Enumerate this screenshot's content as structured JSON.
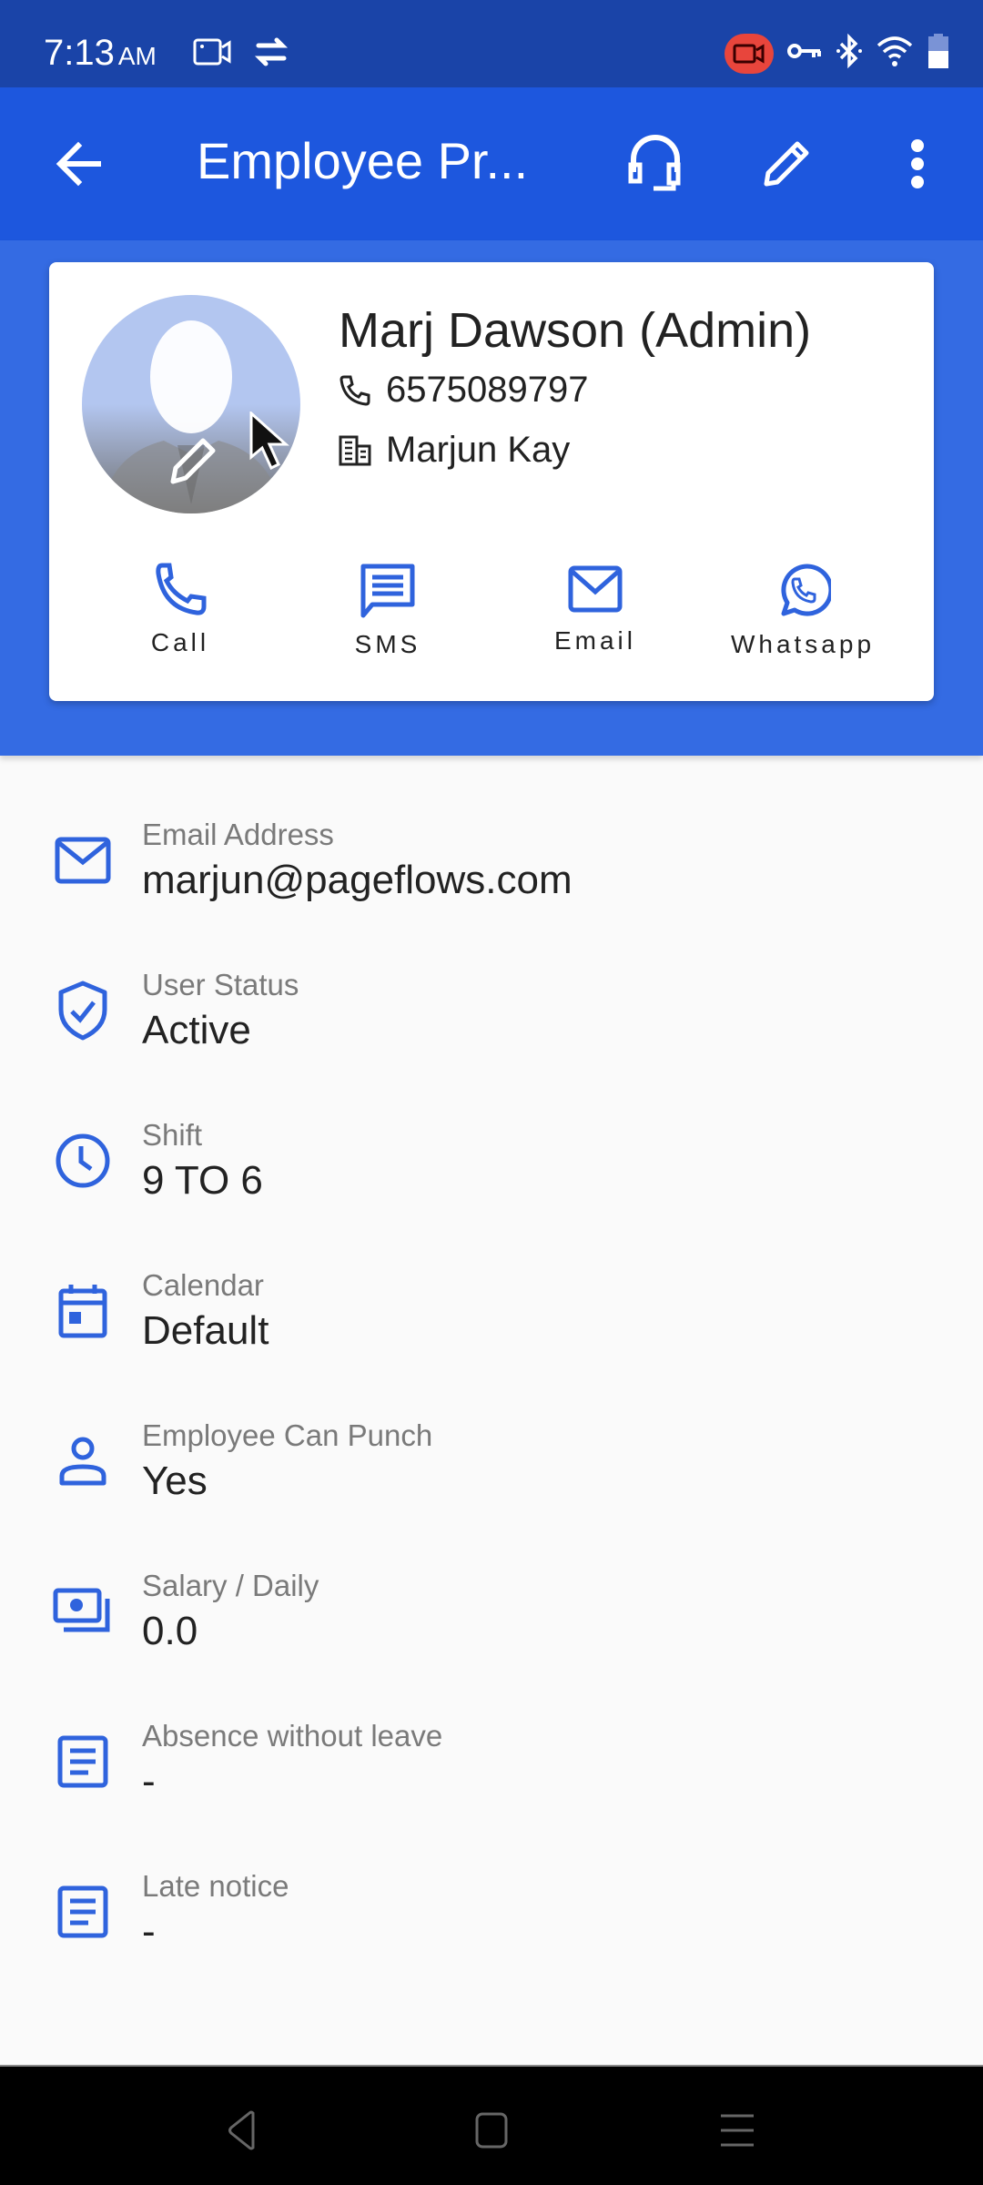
{
  "status_bar": {
    "time": "7:13",
    "ampm": "AM",
    "left_icons": [
      "screen-record-icon",
      "sync-icon"
    ],
    "right_icons": [
      "recording-indicator-icon",
      "vpn-key-icon",
      "bluetooth-icon",
      "wifi-icon",
      "battery-icon"
    ],
    "recording_color": "#e8453c"
  },
  "app_bar": {
    "title": "Employee Pr...",
    "back_icon": "arrow-back-icon",
    "actions": [
      "headset-support-icon",
      "edit-pencil-icon",
      "more-vert-icon"
    ],
    "color": "#1d57de"
  },
  "profile": {
    "name": "Marj Dawson (Admin)",
    "phone": "6575089797",
    "company": "Marjun Kay",
    "avatar_edit_icon": "edit-pencil-icon"
  },
  "contact_actions": [
    {
      "label": "Call",
      "icon": "phone-icon"
    },
    {
      "label": "SMS",
      "icon": "message-icon"
    },
    {
      "label": "Email",
      "icon": "mail-icon"
    },
    {
      "label": "Whatsapp",
      "icon": "whatsapp-icon"
    }
  ],
  "details": [
    {
      "label": "Email Address",
      "value": "marjun@pageflows.com",
      "icon": "mail-icon"
    },
    {
      "label": "User Status",
      "value": "Active",
      "icon": "verified-shield-icon"
    },
    {
      "label": "Shift",
      "value": "9 TO 6",
      "icon": "clock-icon"
    },
    {
      "label": "Calendar",
      "value": "Default",
      "icon": "calendar-icon"
    },
    {
      "label": "Employee Can Punch",
      "value": "Yes",
      "icon": "person-icon"
    },
    {
      "label": "Salary / Daily",
      "value": "0.0",
      "icon": "payments-icon"
    },
    {
      "label": "Absence without leave",
      "value": "-",
      "icon": "article-icon"
    },
    {
      "label": "Late notice",
      "value": "-",
      "icon": "article-icon"
    }
  ],
  "accent_color": "#2f63dd",
  "nav_bar": {
    "buttons": [
      "back-nav-icon",
      "home-nav-icon",
      "recents-nav-icon"
    ]
  }
}
